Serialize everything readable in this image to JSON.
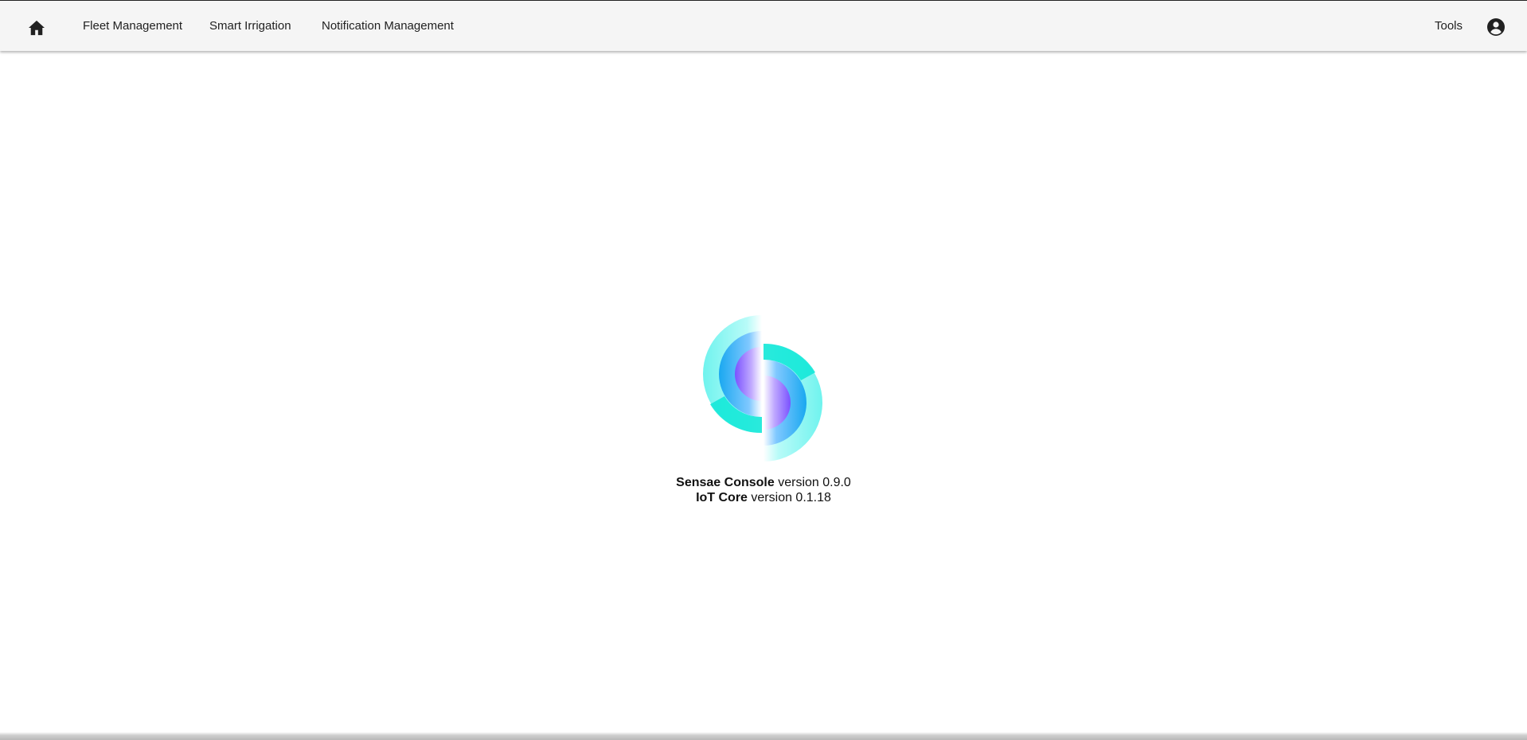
{
  "nav": {
    "home_icon": "home-icon",
    "items": [
      {
        "label": "Fleet Management"
      },
      {
        "label": "Smart Irrigation"
      },
      {
        "label": "Notification Management"
      }
    ],
    "tools_label": "Tools",
    "account_icon": "account-circle-icon"
  },
  "about": {
    "console_name": "Sensae Console",
    "console_version": "version 0.9.0",
    "core_name": "IoT Core",
    "core_version": "version 0.1.18"
  },
  "colors": {
    "topbar_bg": "#f5f5f5",
    "logo_cyan": "#13e8d8",
    "logo_blue": "#1e90ff",
    "logo_violet": "#8a5cff"
  }
}
